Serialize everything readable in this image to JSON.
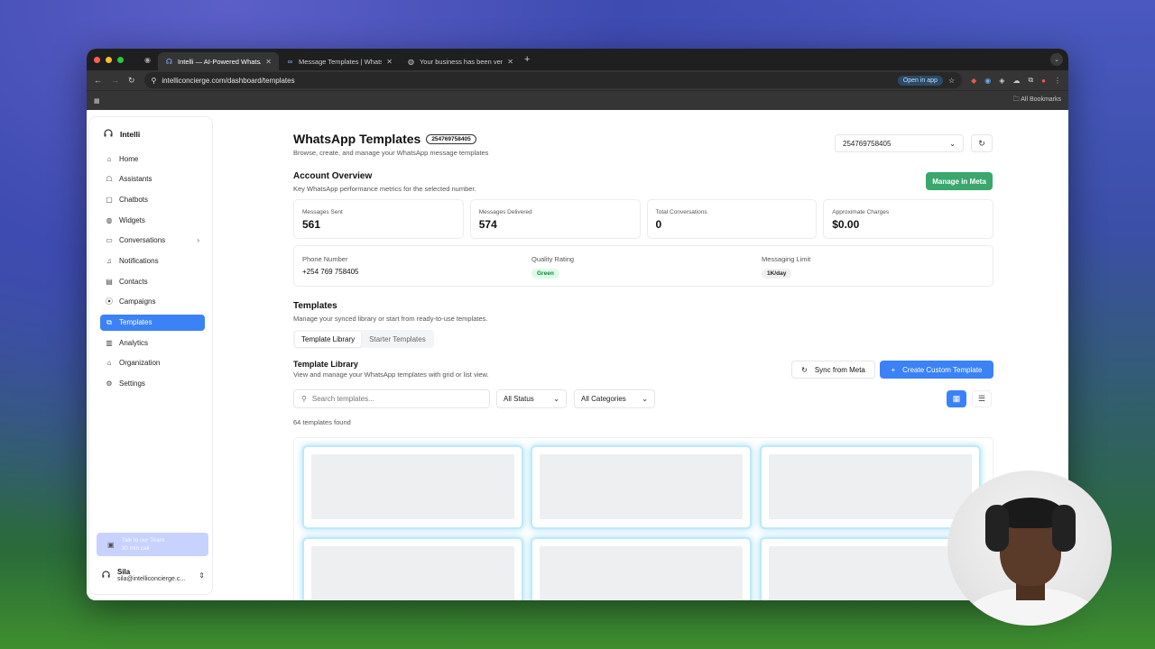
{
  "browser": {
    "tabs": [
      {
        "label": "Intelli — AI-Powered WhatsA",
        "active": true
      },
      {
        "label": "Message Templates | WhatsA",
        "active": false
      },
      {
        "label": "Your business has been verif",
        "active": false
      }
    ],
    "url": "intelliconcierge.com/dashboard/templates",
    "open_in_app": "Open in app",
    "bookmarks_label": "All Bookmarks"
  },
  "sidebar": {
    "brand": "Intelli",
    "items": [
      {
        "label": "Home",
        "icon": "home-icon"
      },
      {
        "label": "Assistants",
        "icon": "robot-icon"
      },
      {
        "label": "Chatbots",
        "icon": "bot-icon"
      },
      {
        "label": "Widgets",
        "icon": "globe-icon"
      },
      {
        "label": "Conversations",
        "icon": "chat-icon"
      },
      {
        "label": "Notifications",
        "icon": "bell-icon"
      },
      {
        "label": "Contacts",
        "icon": "contacts-icon"
      },
      {
        "label": "Campaigns",
        "icon": "broadcast-icon"
      },
      {
        "label": "Templates",
        "icon": "template-icon"
      },
      {
        "label": "Analytics",
        "icon": "bar-chart-icon"
      },
      {
        "label": "Organization",
        "icon": "building-icon"
      },
      {
        "label": "Settings",
        "icon": "gear-icon"
      }
    ],
    "talk": {
      "title": "Talk to our Team",
      "subtitle": "30 min call"
    },
    "user": {
      "name": "Sila",
      "email": "sila@intelliconcierge.c..."
    }
  },
  "header": {
    "title": "WhatsApp Templates",
    "number_pill": "254769758405",
    "subtitle": "Browse, create, and manage your WhatsApp message templates",
    "number_select": "254769758405"
  },
  "overview": {
    "title": "Account Overview",
    "subtitle": "Key WhatsApp performance metrics for the selected number.",
    "manage_button": "Manage in Meta",
    "stats": [
      {
        "label": "Messages Sent",
        "value": "561"
      },
      {
        "label": "Messages Delivered",
        "value": "574"
      },
      {
        "label": "Total Conversations",
        "value": "0"
      },
      {
        "label": "Approximate Charges",
        "value": "$0.00"
      }
    ],
    "phone_label": "Phone Number",
    "phone_value": "+254 769 758405",
    "quality_label": "Quality Rating",
    "quality_value": "Green",
    "limit_label": "Messaging Limit",
    "limit_value": "1K/day"
  },
  "templates": {
    "title": "Templates",
    "subtitle": "Manage your synced library or start from ready-to-use templates.",
    "tabs": [
      "Template Library",
      "Starter Templates"
    ],
    "library_title": "Template Library",
    "library_subtitle": "View and manage your WhatsApp templates with grid or list view.",
    "sync_button": "Sync from Meta",
    "create_button": "Create Custom Template",
    "search_placeholder": "Search templates...",
    "status_filter": "All Status",
    "category_filter": "All Categories",
    "count_text": "64 templates found"
  },
  "colors": {
    "accent": "#3b82f6",
    "meta_green": "#3aa76d"
  }
}
